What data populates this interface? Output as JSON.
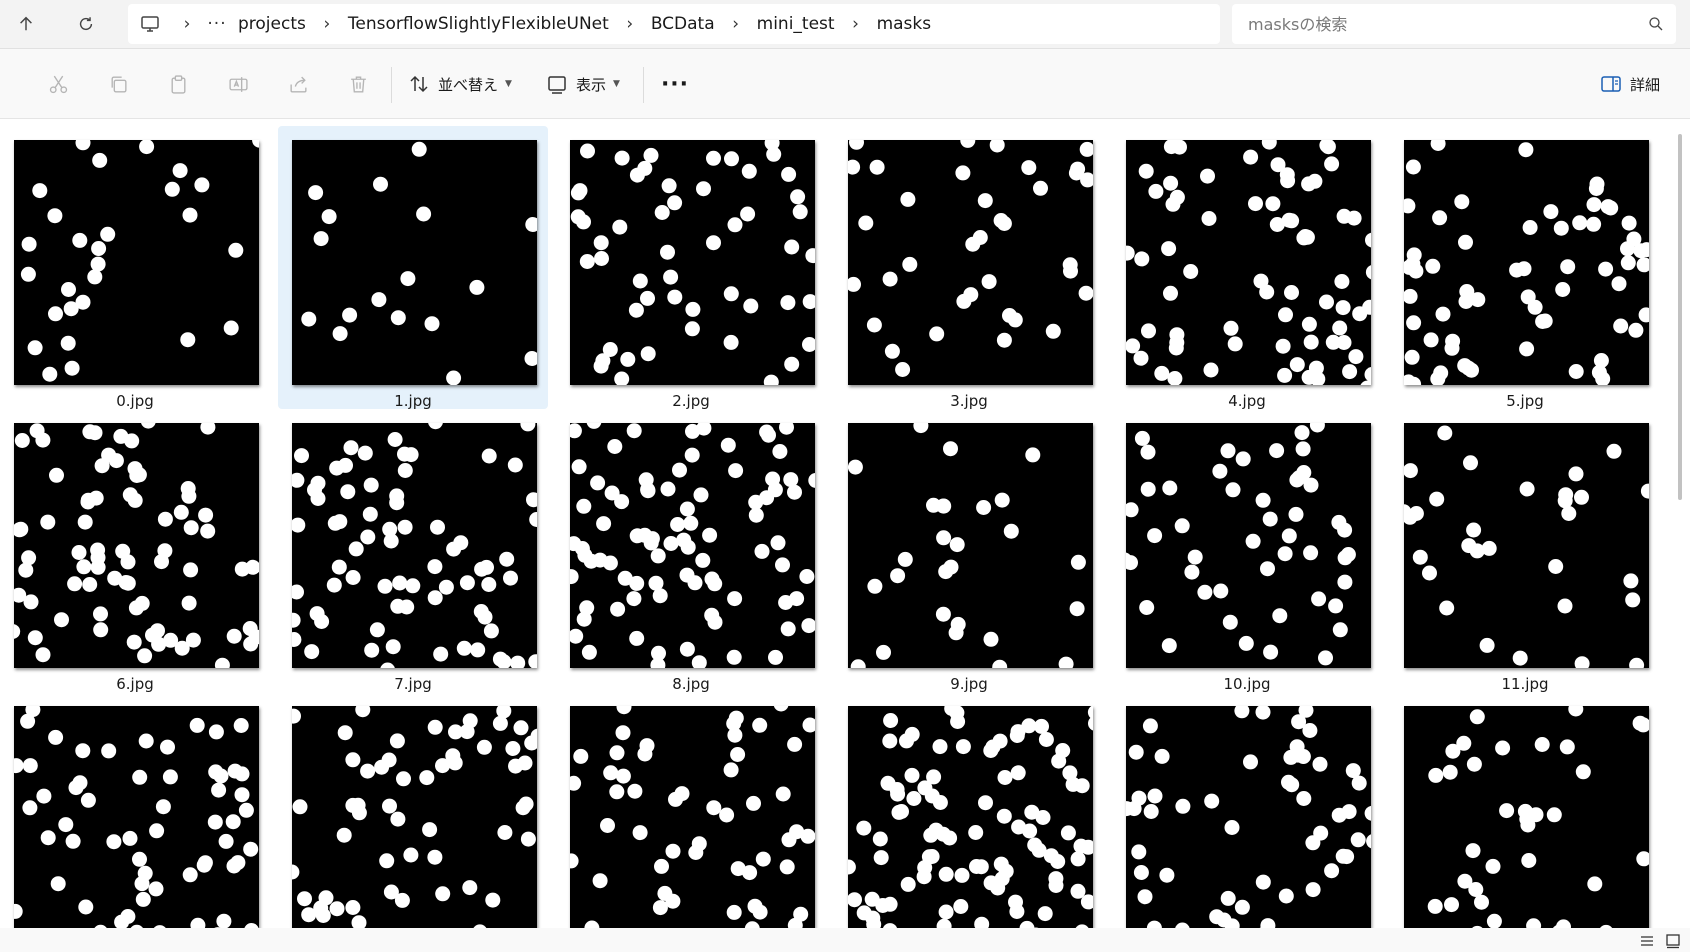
{
  "breadcrumb": {
    "overflow_label": "···",
    "items": [
      "projects",
      "TensorflowSlightlyFlexibleUNet",
      "BCData",
      "mini_test",
      "masks"
    ]
  },
  "search": {
    "placeholder": "masksの検索",
    "value": ""
  },
  "toolbar": {
    "sort_label": "並べ替え",
    "view_label": "表示",
    "more_label": "···",
    "details_label": "詳細"
  },
  "icons": {
    "up": "arrow-up-icon",
    "refresh": "refresh-icon",
    "this_pc": "monitor-icon",
    "search": "search-icon",
    "cut": "scissors-icon",
    "copy": "copy-icon",
    "paste": "paste-icon",
    "rename": "rename-icon",
    "share": "share-icon",
    "delete": "trash-icon",
    "sort": "sort-icon",
    "view": "view-icon",
    "details": "details-pane-icon",
    "details_view": "details-view-icon",
    "tiles_view": "large-icons-view-icon"
  },
  "files": [
    {
      "name": "0.jpg",
      "selected": false
    },
    {
      "name": "1.jpg",
      "selected": true
    },
    {
      "name": "2.jpg",
      "selected": false
    },
    {
      "name": "3.jpg",
      "selected": false
    },
    {
      "name": "4.jpg",
      "selected": false
    },
    {
      "name": "5.jpg",
      "selected": false
    },
    {
      "name": "6.jpg",
      "selected": false
    },
    {
      "name": "7.jpg",
      "selected": false
    },
    {
      "name": "8.jpg",
      "selected": false
    },
    {
      "name": "9.jpg",
      "selected": false
    },
    {
      "name": "10.jpg",
      "selected": false
    },
    {
      "name": "11.jpg",
      "selected": false
    },
    {
      "name": "",
      "selected": false
    },
    {
      "name": "",
      "selected": false
    },
    {
      "name": "",
      "selected": false
    },
    {
      "name": "",
      "selected": false
    },
    {
      "name": "",
      "selected": false
    },
    {
      "name": "",
      "selected": false
    }
  ]
}
